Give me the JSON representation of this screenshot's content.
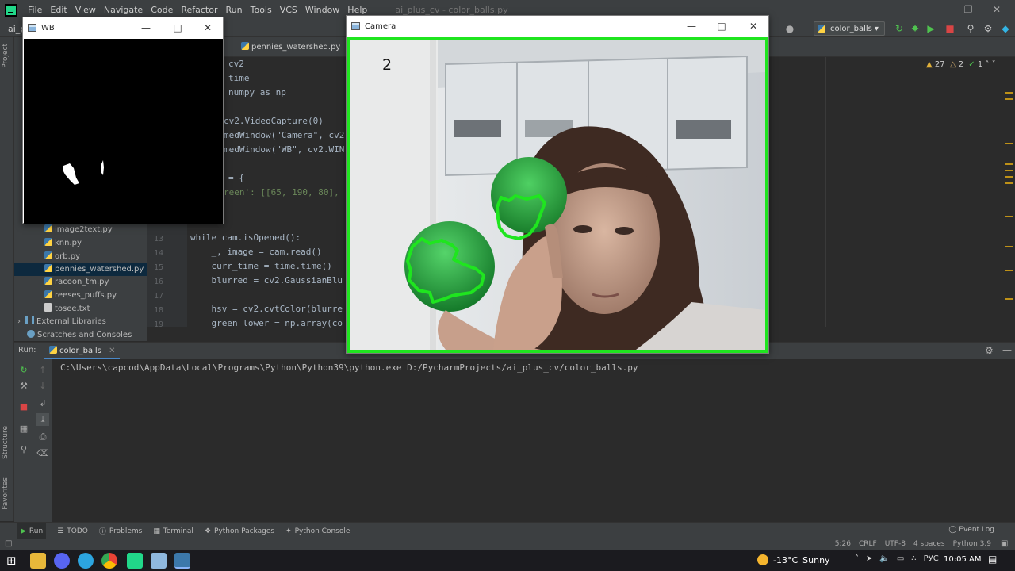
{
  "ide": {
    "window_title": "ai_plus_cv - color_balls.py",
    "project_name": "ai_p",
    "menu": [
      "File",
      "Edit",
      "View",
      "Navigate",
      "Code",
      "Refactor",
      "Run",
      "Tools",
      "VCS",
      "Window",
      "Help"
    ],
    "run_config": "color_balls",
    "editor_tab": "pennies_watershed.py",
    "inspections": {
      "warnings": "27",
      "weak_warnings": "2",
      "typos": "1"
    }
  },
  "left_stripe": {
    "project": "Project",
    "structure": "Structure",
    "favorites": "Favorites"
  },
  "project_tree": {
    "files": [
      "image2text.py",
      "knn.py",
      "orb.py",
      "pennies_watershed.py",
      "racoon_tm.py",
      "reeses_puffs.py",
      "tosee.txt"
    ],
    "external_libraries": "External Libraries",
    "scratches": "Scratches and Consoles"
  },
  "code": {
    "lines": [
      {
        "num": "",
        "text": "cv2"
      },
      {
        "num": "",
        "text": "time"
      },
      {
        "num": "",
        "text": "numpy as np"
      },
      {
        "num": "",
        "text": ""
      },
      {
        "num": "",
        "text": "cv2.VideoCapture(0)"
      },
      {
        "num": "",
        "text": "medWindow(\"Camera\", cv2"
      },
      {
        "num": "",
        "text": "medWindow(\"WB\", cv2.WIN"
      },
      {
        "num": "",
        "text": ""
      },
      {
        "num": "",
        "text": "= {"
      },
      {
        "num": "",
        "text": "reen': [[65, 190, 80],"
      },
      {
        "num": "",
        "text": ""
      },
      {
        "num": "",
        "text": ""
      },
      {
        "num": "13",
        "text": "while cam.isOpened():"
      },
      {
        "num": "14",
        "text": "    _, image = cam.read()"
      },
      {
        "num": "15",
        "text": "    curr_time = time.time()"
      },
      {
        "num": "16",
        "text": "    blurred = cv2.GaussianBlu"
      },
      {
        "num": "17",
        "text": ""
      },
      {
        "num": "18",
        "text": "    hsv = cv2.cvtColor(blurre"
      },
      {
        "num": "19",
        "text": "    green_lower = np.array(co"
      }
    ]
  },
  "run_panel": {
    "label": "Run:",
    "tab": "color_balls",
    "console_line": "C:\\Users\\capcod\\AppData\\Local\\Programs\\Python\\Python39\\python.exe D:/PycharmProjects/ai_plus_cv/color_balls.py"
  },
  "bottom_tools": [
    "Run",
    "TODO",
    "Problems",
    "Terminal",
    "Python Packages",
    "Python Console"
  ],
  "event_log": "Event Log",
  "status": {
    "position": "5:26",
    "line_sep": "CRLF",
    "encoding": "UTF-8",
    "indent": "4 spaces",
    "interpreter": "Python 3.9"
  },
  "taskbar": {
    "temperature": "-13°C",
    "weather": "Sunny",
    "language": "РУС",
    "time": "10:05 AM"
  },
  "wb_window": {
    "title": "WB"
  },
  "camera_window": {
    "title": "Camera",
    "ball_count": "2"
  },
  "colors": {
    "contour": "#1fe51f",
    "ide_bg": "#2b2b2b",
    "panel": "#3c3f41"
  }
}
